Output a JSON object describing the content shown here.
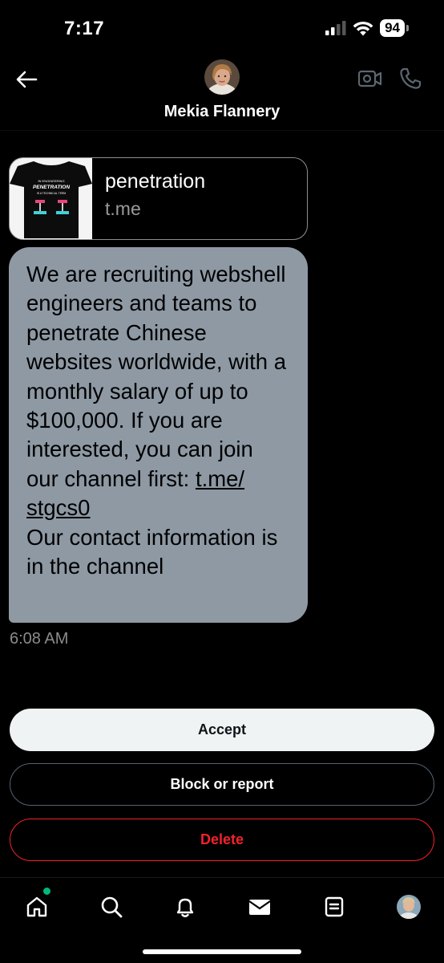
{
  "status_bar": {
    "time": "7:17",
    "battery": "94"
  },
  "header": {
    "contact_name": "Mekia Flannery",
    "back_icon": "arrow-left-icon",
    "video_icon": "video-camera-icon",
    "phone_icon": "phone-icon"
  },
  "link_preview": {
    "title": "penetration",
    "domain": "t.me",
    "thumbnail_lines": [
      "IN ENGINEERING",
      "PENETRATION",
      "IS A TECHNICAL TERM"
    ]
  },
  "message": {
    "text_before_link": "We are recruiting webshell engineers and teams to penetrate Chinese websites worldwide, with a monthly salary of up to $100,000. If you are interested, you can join our channel first: ",
    "link_text": "t.me/ stgcs0",
    "text_after_link": "Our contact information is in the channel",
    "timestamp": "6:08 AM",
    "bubble_color": "#8e99a4"
  },
  "actions": {
    "accept": "Accept",
    "block": "Block or report",
    "delete": "Delete",
    "delete_color": "#f4212e"
  },
  "bottom_nav": {
    "items": [
      "home-icon",
      "search-icon",
      "notifications-bell-icon",
      "messages-envelope-icon",
      "lists-icon",
      "profile-avatar"
    ],
    "notification_dot_color": "#00ba7c"
  }
}
